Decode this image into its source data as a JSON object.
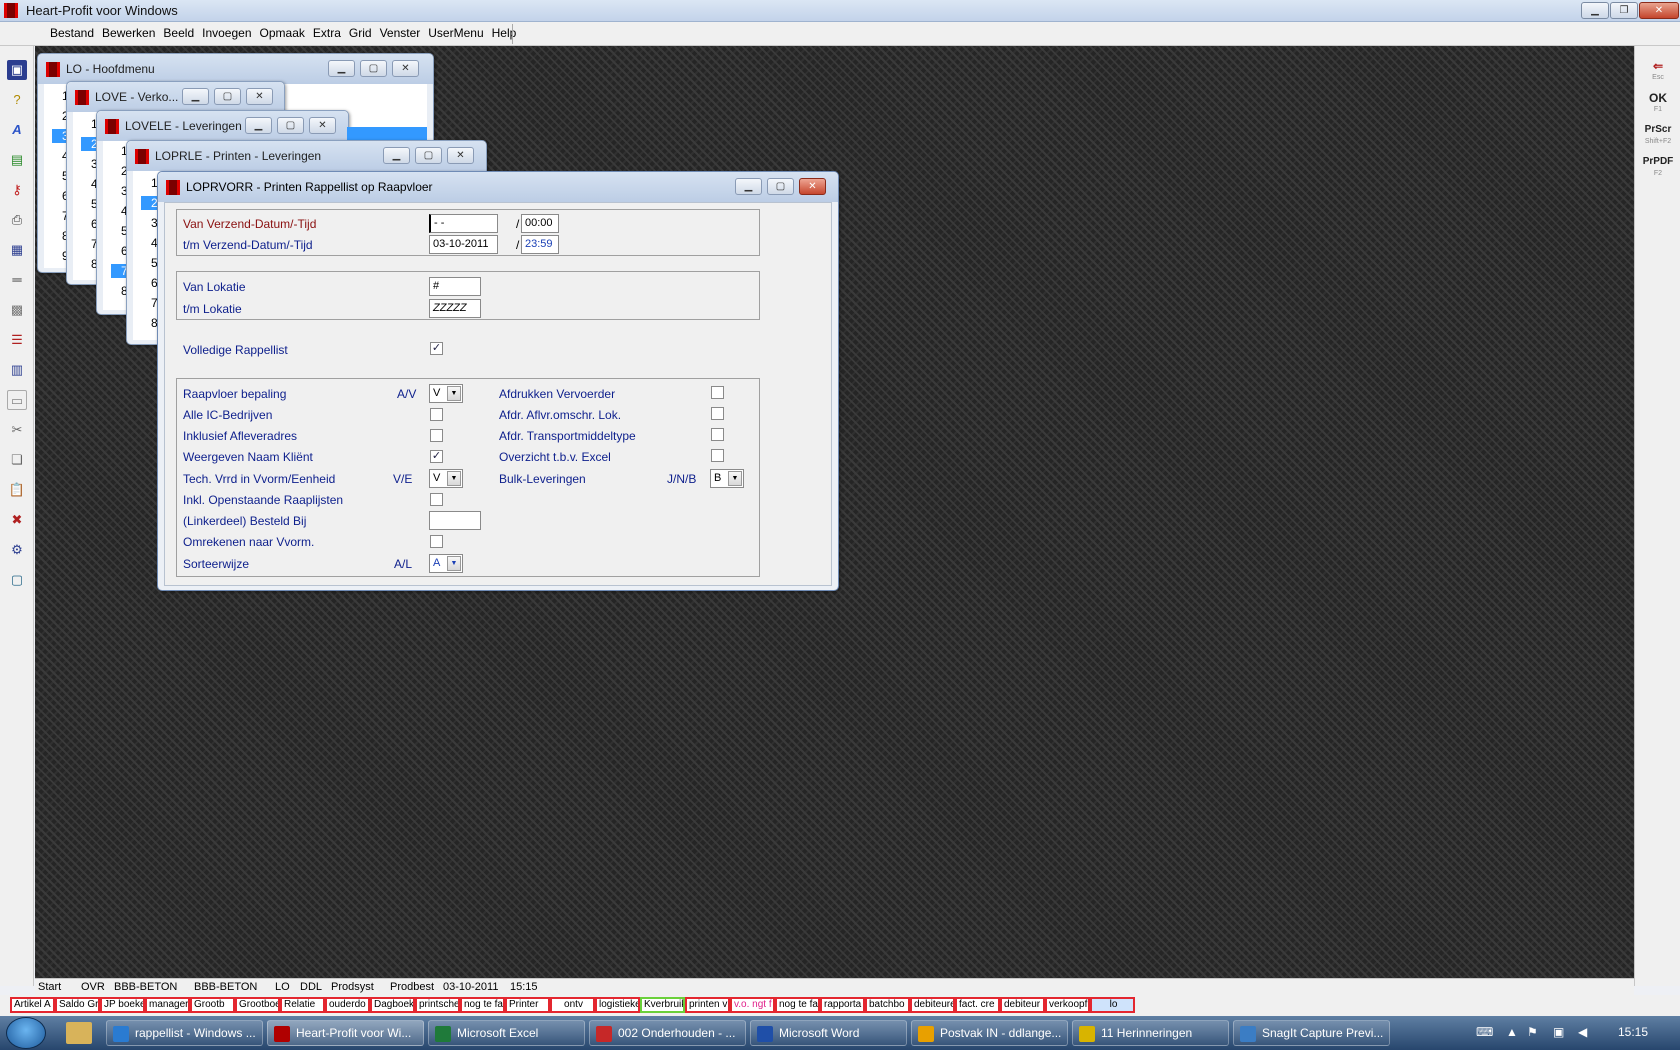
{
  "app": {
    "title": "Heart-Profit voor Windows"
  },
  "menu": [
    "Bestand",
    "Bewerken",
    "Beeld",
    "Invoegen",
    "Opmaak",
    "Extra",
    "Grid",
    "Venster",
    "UserMenu",
    "Help"
  ],
  "rtool": [
    {
      "l": "Esc",
      "s": ""
    },
    {
      "l": "OK",
      "s": "F1"
    },
    {
      "l": "PrScr",
      "s": "Shift+F2"
    },
    {
      "l": "PrPDF",
      "s": "F2"
    }
  ],
  "windows": {
    "w1": {
      "title": "LO - Hoofdmenu",
      "nums": [
        "1",
        "2",
        "3",
        "4",
        "5",
        "6",
        "7",
        "8",
        "9"
      ]
    },
    "w2": {
      "title": "LOVE - Verko...",
      "nums": [
        "1",
        "2",
        "3",
        "4",
        "5",
        "6",
        "7",
        "8"
      ]
    },
    "w3": {
      "title": "LOVELE - Leveringen",
      "nums": [
        "1",
        "2",
        "3",
        "4",
        "5",
        "6",
        "7",
        "8"
      ]
    },
    "w4": {
      "title": "LOPRLE - Printen - Leveringen",
      "nums": [
        "1",
        "2",
        "3",
        "4",
        "5",
        "6",
        "7",
        "8"
      ]
    }
  },
  "dialog": {
    "title": "LOPRVORR - Printen Rappellist op Raapvloer",
    "van_datum_label": "Van Verzend-Datum/-Tijd",
    "van_datum": "- -",
    "van_tijd": "00:00",
    "tm_datum_label": "t/m Verzend-Datum/-Tijd",
    "tm_datum": "03-10-2011",
    "tm_tijd": "23:59",
    "slash": "/",
    "van_lok_label": "Van Lokatie",
    "van_lok": "#",
    "tm_lok_label": "t/m Lokatie",
    "tm_lok": "ZZZZZ",
    "volledig_label": "Volledige Rappellist",
    "raap_label": "Raapvloer bepaling",
    "raap_hint": "A/V",
    "raap_val": "V",
    "ic_label": "Alle IC-Bedrijven",
    "inkl_label": "Inklusief Afleveradres",
    "naam_label": "Weergeven Naam Kliënt",
    "tech_label": "Tech. Vrrd in Vvorm/Eenheid",
    "tech_hint": "V/E",
    "tech_val": "V",
    "open_label": "Inkl. Openstaande Raaplijsten",
    "link_label": "(Linkerdeel) Besteld Bij",
    "omr_label": "Omrekenen naar Vvorm.",
    "sort_label": "Sorteerwijze",
    "sort_hint": "A/L",
    "sort_val": "A",
    "afdr_verv_label": "Afdrukken Vervoerder",
    "afdr_lok_label": "Afdr. Aflvr.omschr. Lok.",
    "afdr_tr_label": "Afdr. Transportmiddeltype",
    "excel_label": "Overzicht t.b.v. Excel",
    "bulk_label": "Bulk-Leveringen",
    "bulk_hint": "J/N/B",
    "bulk_val": "B",
    "check": "✓"
  },
  "status": {
    "start": "Start",
    "ovr": "OVR",
    "c1": "BBB-BETON",
    "c2": "BBB-BETON",
    "lo": "LO",
    "ddl": "DDL",
    "prodsyst": "Prodsyst",
    "prodbest": "Prodbest",
    "date": "03-10-2011",
    "time": "15:15"
  },
  "usermenu": [
    "Artikel A",
    "Saldo Gr",
    "JP boeke",
    "manager",
    "Grootb",
    "Grootboe",
    "Relatie",
    "ouderdo",
    "Dagboek",
    "printsche",
    "nog te fa",
    "Printer",
    "ontv",
    "logistieke",
    "Kverbruik",
    "printen v",
    "v.o. ngt f",
    "nog te fa",
    "rapporta",
    "batchbo",
    "debiteure",
    "fact. cre",
    "debiteur",
    "verkoopf",
    "lo"
  ],
  "taskbar": [
    {
      "label": "rappellist - Windows ...",
      "color": "#2a7bd1"
    },
    {
      "label": "Heart-Profit voor Wi...",
      "color": "#b00000"
    },
    {
      "label": "Microsoft Excel",
      "color": "#1f7a3a"
    },
    {
      "label": "002 Onderhouden - ...",
      "color": "#c62828"
    },
    {
      "label": "Microsoft Word",
      "color": "#1f4fa8"
    },
    {
      "label": "Postvak IN - ddlange...",
      "color": "#e8a000"
    },
    {
      "label": "11 Herinneringen",
      "color": "#d8b400"
    },
    {
      "label": "SnagIt Capture Previ...",
      "color": "#3b7dc4"
    }
  ],
  "clock": "15:15"
}
